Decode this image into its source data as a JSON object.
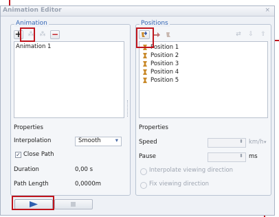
{
  "window": {
    "title": "Animation Editor",
    "close_glyph": "×"
  },
  "animation": {
    "group_label": "Animation",
    "toolbar": [
      {
        "name": "add-animation-button",
        "glyph": "+"
      },
      {
        "name": "animation-tool-2-button",
        "glyph": "⁂"
      },
      {
        "name": "animation-tool-3-button",
        "glyph": "⁂"
      },
      {
        "name": "remove-animation-button",
        "glyph": "−"
      }
    ],
    "items": [
      "Animation 1"
    ],
    "properties_label": "Properties",
    "interpolation_label": "Interpolation",
    "interpolation_value": "Smooth",
    "close_path_label": "Close Path",
    "close_path_checked": true,
    "duration_label": "Duration",
    "duration_value": "0,00 s",
    "path_length_label": "Path Length",
    "path_length_value": "0,0000m"
  },
  "positions": {
    "group_label": "Positions",
    "items": [
      "Position 1",
      "Position 2",
      "Position 3",
      "Position 4",
      "Position 5"
    ],
    "properties_label": "Properties",
    "speed_label": "Speed",
    "speed_unit": "km/h",
    "pause_label": "Pause",
    "pause_unit": "ms",
    "interpolate_label": "Interpolate viewing direction",
    "fix_label": "Fix viewing direction"
  },
  "colors": {
    "callout": "#c0141c",
    "group_label": "#3567b5",
    "play": "#2f5fb0"
  }
}
